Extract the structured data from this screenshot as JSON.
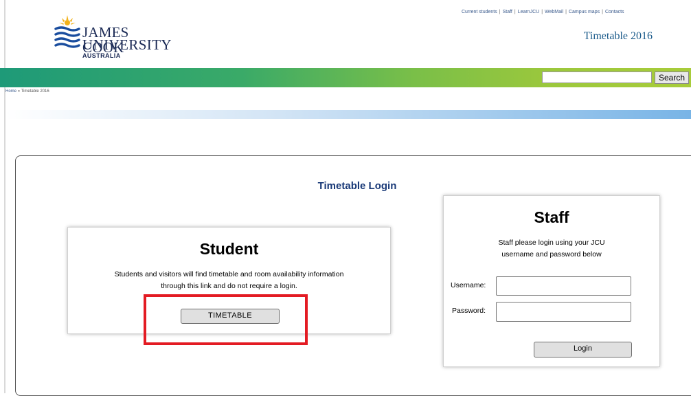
{
  "header": {
    "logo": {
      "line1": "JAMES COOK",
      "line2": "UNIVERSITY",
      "line3": "AUSTRALIA"
    },
    "util_links": [
      "Current students",
      "Staff",
      "LearnJCU",
      "WebMail",
      "Campus maps",
      "Contacts"
    ],
    "site_title": "Timetable 2016",
    "search": {
      "value": "",
      "placeholder": "",
      "button_label": "Search"
    }
  },
  "breadcrumb": {
    "home": "Home",
    "separator": "»",
    "current": "Timetable 2016"
  },
  "main": {
    "title": "Timetable Login",
    "student": {
      "heading": "Student",
      "text_line1": "Students and visitors will find timetable and room availability information",
      "text_line2": "through this link and do not require a login.",
      "button_label": "TIMETABLE"
    },
    "staff": {
      "heading": "Staff",
      "text_line1": "Staff please login using your JCU",
      "text_line2": "username and password below",
      "username_label": "Username:",
      "username_value": "",
      "password_label": "Password:",
      "password_value": "",
      "button_label": "Login"
    }
  },
  "colors": {
    "brand_navy": "#1b2a55",
    "title_blue": "#1a5a8a",
    "login_title": "#1a3a78",
    "bar_green_start": "#1e9a78",
    "bar_green_end": "#a8cc3a",
    "highlight_red": "#e31b23"
  }
}
